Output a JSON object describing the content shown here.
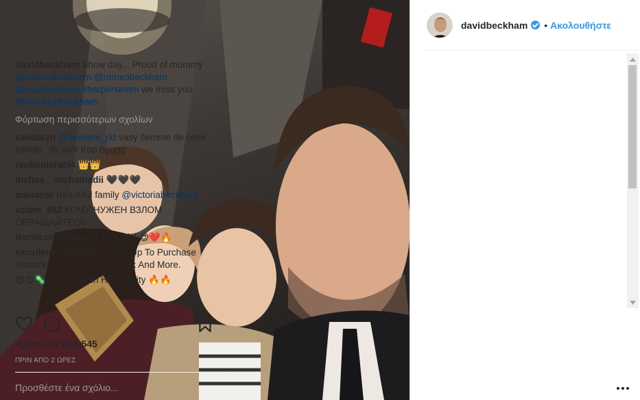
{
  "post": {
    "username": "davidbeckham",
    "follow_label": "Ακολουθήστε",
    "separator": "•"
  },
  "caption": {
    "username": "davidbeckham",
    "text_1": "Show day... Proud of mummy",
    "mention_1": "@victoriabeckham",
    "mention_2": "@romeobeckham",
    "mention_3": "@cruzbeckham",
    "hashtag": "#harperseven",
    "text_2": "we miss you",
    "mention_4": "@brooklynbeckham"
  },
  "load_more": "Φόρτωση περισσότερων σχολίων",
  "comments": [
    {
      "username": "sandarzn",
      "mention": "@lauriane_rkt",
      "text": "vasy flemme de cette famille , ils sont trop bgggg"
    },
    {
      "username": "reubenisrael4",
      "mention": "",
      "text": "👑👑"
    },
    {
      "username": "mahsa__mohamadii",
      "mention": "",
      "text": "🖤🖤🖤"
    },
    {
      "username": "mairarisi",
      "mention": "@victoriabeckham",
      "text": "Beautiful family"
    },
    {
      "username": "vzlom_882",
      "mention": "",
      "text": "КОМУ НУЖЕН ВЗЛОМ ОБРАЩАЙТЕСЬ"
    },
    {
      "username": "leonie.chavanon14",
      "mention": "",
      "text": "Beautiful 😍❤️🔥"
    },
    {
      "username": "excellent_graphics",
      "mention": "",
      "text": "Hit Me Up To Purchase Artwork, Cartoon Covers, Gfx And More."
    },
    {
      "username": "",
      "mention": "",
      "text": "😍😍🦠 ... All Stylish HD Quality 🔥🔥"
    }
  ],
  "likes": {
    "label": "Αρέσει σε",
    "count": "848,545"
  },
  "timestamp": "ΠΡΙΝ ΑΠΟ 2 ΩΡΕΣ",
  "comment_box": {
    "placeholder": "Προσθέστε ένα σχόλιο..."
  },
  "icons": {
    "like": "heart-icon",
    "comment": "comment-bubble-icon",
    "save": "bookmark-icon",
    "more": "more-options-icon",
    "verified": "verified-badge-icon"
  },
  "colors": {
    "accent": "#3897f0",
    "mention": "#003569",
    "muted": "#999999",
    "text": "#262626"
  }
}
